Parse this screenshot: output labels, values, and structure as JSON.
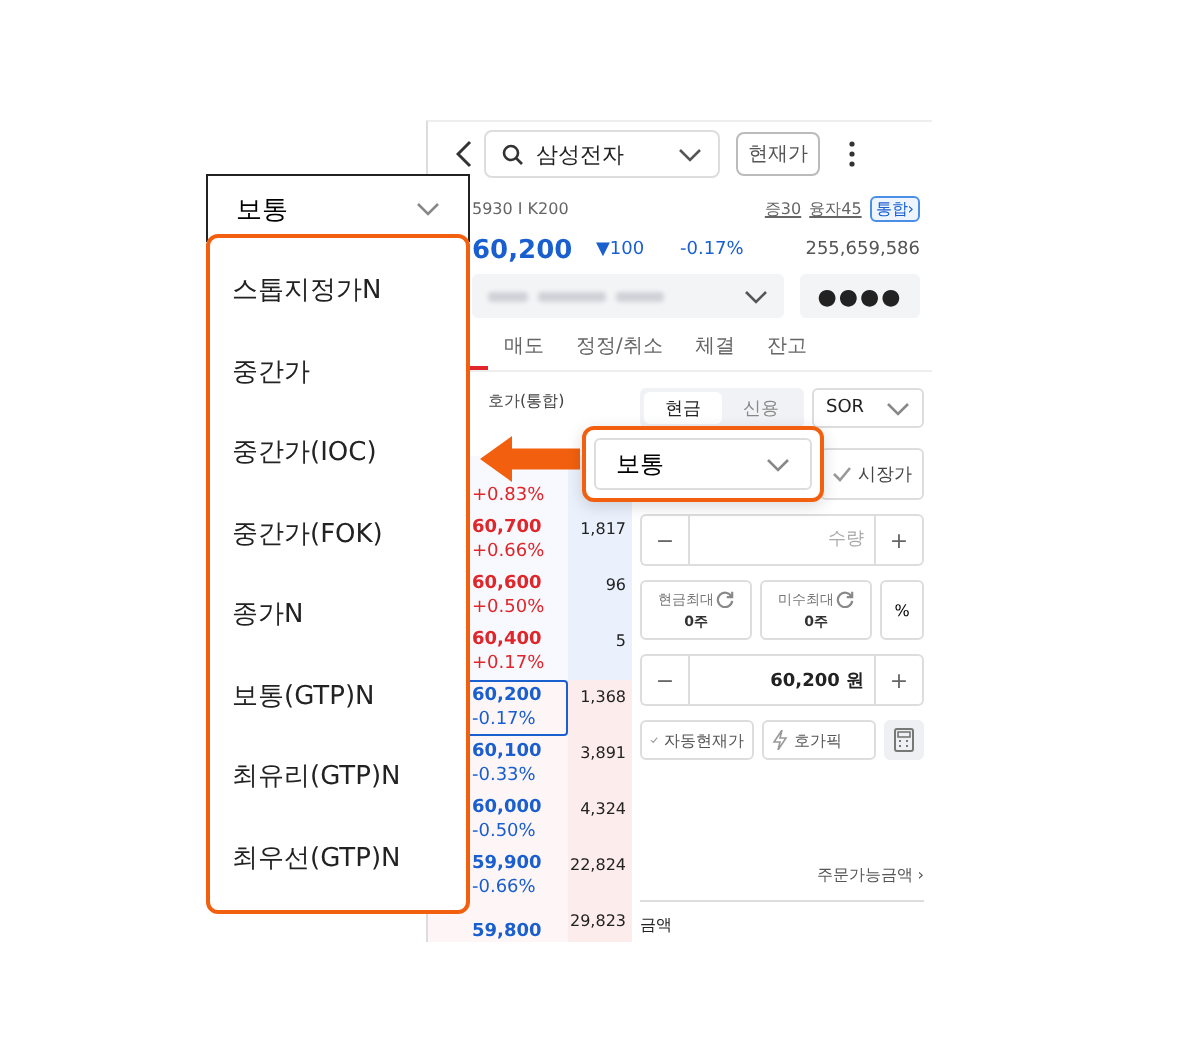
{
  "header": {
    "search": {
      "value": "삼성전자"
    },
    "price_button": "현재가"
  },
  "stock_info": {
    "code": "5930 I K200",
    "margin": "증30",
    "loan": "융자45",
    "badge": "통합›"
  },
  "quote": {
    "price": "60,200",
    "change": "▼100",
    "rate": "-0.17%",
    "volume": "255,659,586"
  },
  "account": {
    "password": "●●●●"
  },
  "tabs": [
    {
      "label": "매도",
      "selected": false
    },
    {
      "label": "정정/취소",
      "selected": false
    },
    {
      "label": "체결",
      "selected": false
    },
    {
      "label": "잔고",
      "selected": false
    }
  ],
  "order_book": {
    "header": "호가(통합)",
    "rows": [
      {
        "change": "+0.83%",
        "kind": "ask",
        "selected": false
      },
      {
        "price": "60,700",
        "change": "+0.66%",
        "volume": "1,817",
        "kind": "ask",
        "selected": false
      },
      {
        "price": "60,600",
        "change": "+0.50%",
        "volume": "96",
        "kind": "ask",
        "selected": false
      },
      {
        "price": "60,400",
        "change": "+0.17%",
        "volume": "5",
        "kind": "ask",
        "selected": false
      },
      {
        "price": "60,200",
        "change": "-0.17%",
        "volume": "1,368",
        "kind": "bid",
        "selected": true
      },
      {
        "price": "60,100",
        "change": "-0.33%",
        "volume": "3,891",
        "kind": "bid",
        "selected": false
      },
      {
        "price": "60,000",
        "change": "-0.50%",
        "volume": "4,324",
        "kind": "bid",
        "selected": false
      },
      {
        "price": "59,900",
        "change": "-0.66%",
        "volume": "22,824",
        "kind": "bid",
        "selected": false
      },
      {
        "price": "59,800",
        "volume": "29,823",
        "kind": "bid",
        "selected": false
      }
    ]
  },
  "order_panel": {
    "account_types": [
      {
        "label": "현금",
        "selected": true
      },
      {
        "label": "신용",
        "selected": false
      }
    ],
    "route": "SOR",
    "market_price": {
      "label": "시장가",
      "checked": false
    },
    "quantity": {
      "placeholder": "수량",
      "decrement": "−",
      "increment": "+"
    },
    "max_buttons": [
      {
        "label": "현금최대",
        "value": "0주"
      },
      {
        "label": "미수최대",
        "value": "0주"
      }
    ],
    "percent": "%",
    "price": {
      "value": "60,200 원",
      "decrement": "−",
      "increment": "+"
    },
    "auto_price": {
      "label": "자동현재가",
      "checked": false
    },
    "hoga_pick": "호가픽",
    "available_amount": "주문가능금액 ›",
    "amount_label": "금액"
  },
  "order_type_dropdown": {
    "value": "보통",
    "options": [
      "스톱지정가N",
      "중간가",
      "중간가(IOC)",
      "중간가(FOK)",
      "종가N",
      "보통(GTP)N",
      "최유리(GTP)N",
      "최우선(GTP)N"
    ]
  },
  "callout": {
    "value": "보통"
  }
}
